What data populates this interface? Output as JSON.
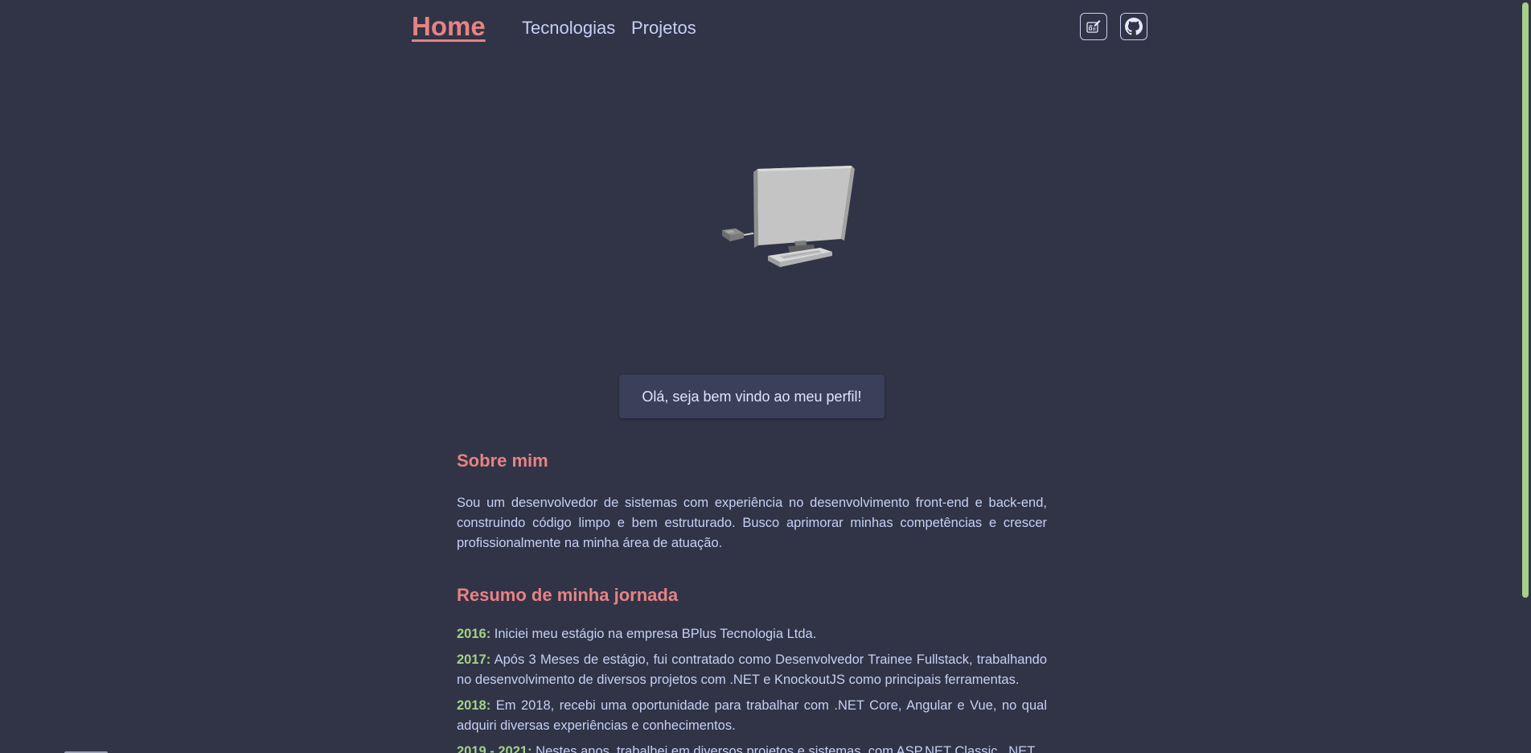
{
  "nav": {
    "home_label": "Home",
    "links": [
      {
        "label": "Tecnologias"
      },
      {
        "label": "Projetos"
      }
    ],
    "icons": [
      "blog-edit-icon",
      "github-icon"
    ]
  },
  "welcome": {
    "text": "Olá, seja bem vindo ao meu perfil!"
  },
  "about": {
    "title": "Sobre mim",
    "text": "Sou um desenvolvedor de sistemas com experiência no desenvolvimento front-end e back-end, construindo código limpo e bem estruturado. Busco aprimorar minhas competências e crescer profissionalmente na minha área de atuação."
  },
  "journey": {
    "title": "Resumo de minha jornada",
    "items": [
      {
        "year": "2016:",
        "text": " Iniciei meu estágio na empresa BPlus Tecnologia Ltda."
      },
      {
        "year": "2017:",
        "text": " Após 3 Meses de estágio, fui contratado como Desenvolvedor Trainee Fullstack, trabalhando no desenvolvimento de diversos projetos com .NET e KnockoutJS como principais ferramentas."
      },
      {
        "year": "2018:",
        "text": " Em 2018, recebi uma oportunidade para trabalhar com .NET Core, Angular e Vue, no qual adquiri diversas experiências e conhecimentos."
      },
      {
        "year": "2019 - 2021:",
        "text": " Nestes anos, trabalhei em diversos projetos e sistemas, com ASP.NET Classic, .NET"
      }
    ]
  },
  "colors": {
    "background": "#303446",
    "accent": "#e78284",
    "year": "#a6d189",
    "text": "#c6d0f5"
  }
}
